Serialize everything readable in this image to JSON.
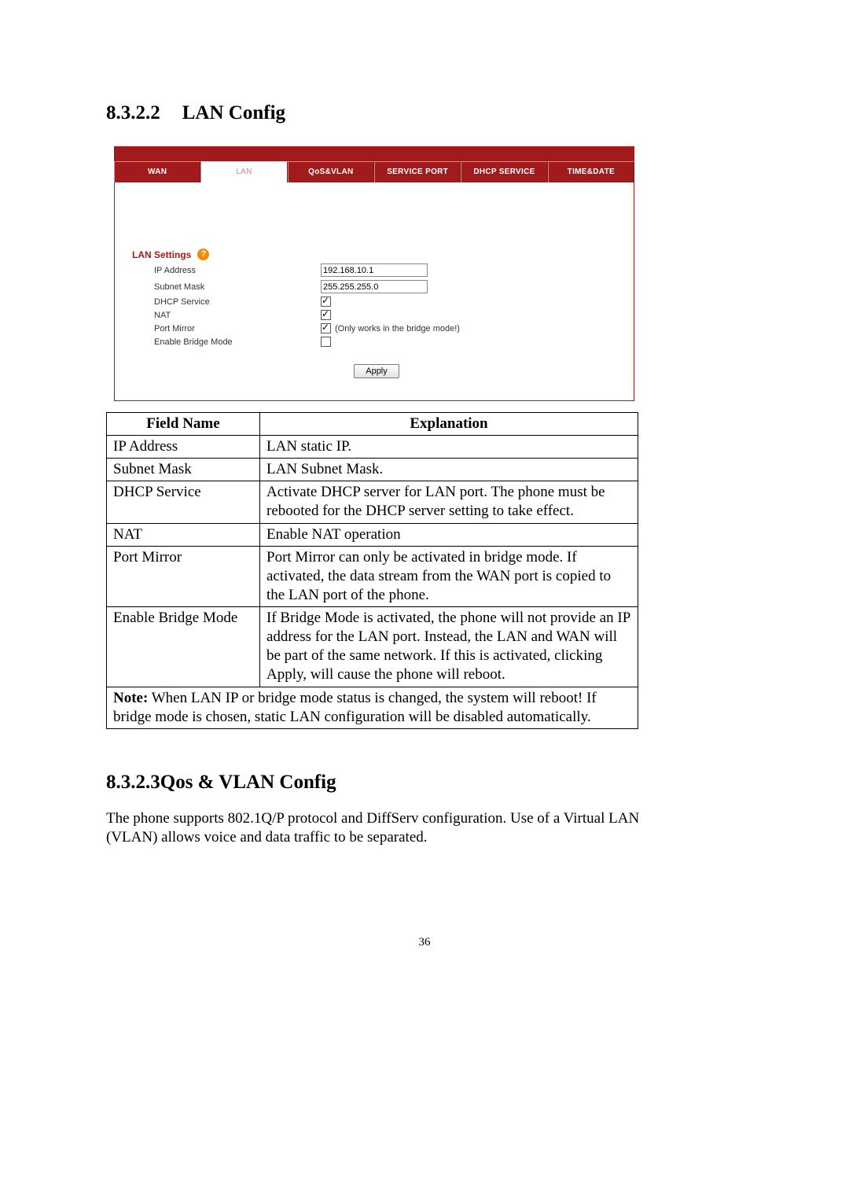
{
  "section1": {
    "number": "8.3.2.2",
    "title": "LAN Config"
  },
  "router": {
    "tabs": [
      "WAN",
      "LAN",
      "QoS&VLAN",
      "SERVICE PORT",
      "DHCP SERVICE",
      "TIME&DATE"
    ],
    "section_label": "LAN Settings",
    "help_glyph": "?",
    "rows": {
      "ip_label": "IP Address",
      "ip_value": "192.168.10.1",
      "mask_label": "Subnet Mask",
      "mask_value": "255.255.255.0",
      "dhcp_label": "DHCP Service",
      "nat_label": "NAT",
      "pm_label": "Port Mirror",
      "pm_note": "(Only works in the bridge mode!)",
      "bridge_label": "Enable Bridge Mode"
    },
    "apply_label": "Apply"
  },
  "table": {
    "head_field": "Field Name",
    "head_expl": "Explanation",
    "rows": [
      {
        "f": "IP Address",
        "e": "LAN static IP."
      },
      {
        "f": "Subnet Mask",
        "e": "LAN Subnet Mask."
      },
      {
        "f": "DHCP Service",
        "e": "Activate DHCP server for LAN port.    The phone must be rebooted for the DHCP server setting to take effect."
      },
      {
        "f": "NAT",
        "e": "Enable NAT operation"
      },
      {
        "f": "Port Mirror",
        "e": "Port Mirror can only be activated in bridge mode.    If activated, the data stream from the WAN port is copied to the LAN port of the phone."
      },
      {
        "f": "Enable Bridge Mode",
        "e": "If Bridge Mode is activated, the phone will not provide an IP address for the LAN port.    Instead, the LAN and WAN will be part of the same network.    If this is activated, clicking Apply, will cause the phone will reboot."
      }
    ],
    "note_bold": "Note:",
    "note_rest": " When LAN IP or bridge mode status is changed, the system will reboot!    If bridge mode is chosen, static LAN configuration will be disabled automatically."
  },
  "section2": {
    "number": "8.3.2.3",
    "title": "Qos & VLAN Config"
  },
  "para": "The phone supports 802.1Q/P protocol and DiffServ configuration. Use of a Virtual LAN (VLAN) allows voice and data traffic to be separated.",
  "page_number": "36"
}
